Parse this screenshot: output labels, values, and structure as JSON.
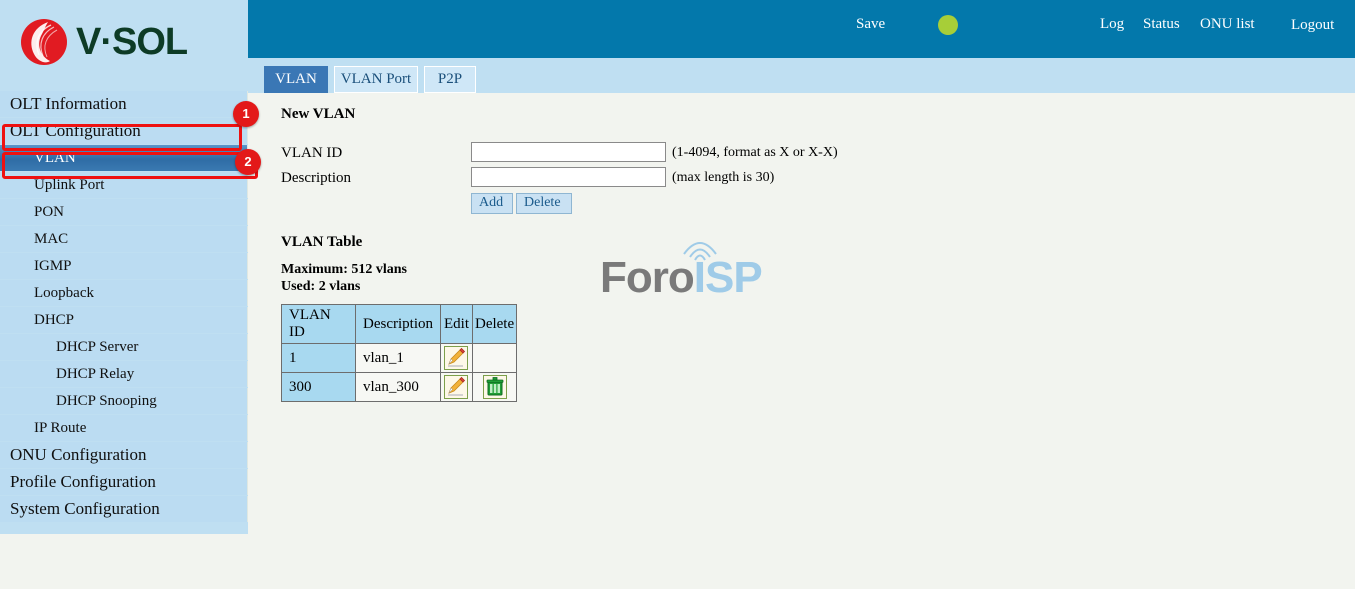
{
  "brand": {
    "name": "V·SOL",
    "logo_icon": "vsol-circle-logo"
  },
  "topbar": {
    "save_label": "Save",
    "status_indicator": "green-status-dot",
    "links": [
      {
        "label": "Log"
      },
      {
        "label": "Status"
      },
      {
        "label": "ONU list"
      },
      {
        "label": "Logout"
      }
    ]
  },
  "tabs": [
    {
      "label": "VLAN",
      "active": true
    },
    {
      "label": "VLAN Port",
      "active": false
    },
    {
      "label": "P2P",
      "active": false
    }
  ],
  "sidebar": {
    "items": [
      {
        "label": "OLT Information",
        "level": 0,
        "active": false
      },
      {
        "label": "OLT Configuration",
        "level": 0,
        "active": false
      },
      {
        "label": "VLAN",
        "level": 1,
        "active": true
      },
      {
        "label": "Uplink Port",
        "level": 1,
        "active": false
      },
      {
        "label": "PON",
        "level": 1,
        "active": false
      },
      {
        "label": "MAC",
        "level": 1,
        "active": false
      },
      {
        "label": "IGMP",
        "level": 1,
        "active": false
      },
      {
        "label": "Loopback",
        "level": 1,
        "active": false
      },
      {
        "label": "DHCP",
        "level": 1,
        "active": false
      },
      {
        "label": "DHCP Server",
        "level": 2,
        "active": false
      },
      {
        "label": "DHCP Relay",
        "level": 2,
        "active": false
      },
      {
        "label": "DHCP Snooping",
        "level": 2,
        "active": false
      },
      {
        "label": "IP Route",
        "level": 1,
        "active": false
      },
      {
        "label": "ONU Configuration",
        "level": 0,
        "active": false
      },
      {
        "label": "Profile Configuration",
        "level": 0,
        "active": false
      },
      {
        "label": "System Configuration",
        "level": 0,
        "active": false
      }
    ]
  },
  "annotations": [
    {
      "number": "1",
      "target": "OLT Configuration"
    },
    {
      "number": "2",
      "target": "VLAN"
    }
  ],
  "new_vlan": {
    "heading": "New VLAN",
    "vlan_id_label": "VLAN ID",
    "vlan_id_value": "",
    "vlan_id_hint": "(1-4094, format as X or X-X)",
    "description_label": "Description",
    "description_value": "",
    "description_hint": "(max length is 30)",
    "add_label": "Add",
    "delete_label": "Delete"
  },
  "vlan_table": {
    "heading": "VLAN Table",
    "maximum_line": "Maximum: 512 vlans",
    "used_line": "Used: 2 vlans",
    "columns": [
      "VLAN ID",
      "Description",
      "Edit",
      "Delete"
    ],
    "rows": [
      {
        "vlan_id": "1",
        "description": "vlan_1",
        "edit_icon": "pencil-edit-icon",
        "delete_icon": ""
      },
      {
        "vlan_id": "300",
        "description": "vlan_300",
        "edit_icon": "pencil-edit-icon",
        "delete_icon": "trash-delete-icon"
      }
    ]
  },
  "watermark": {
    "text_primary": "Foro",
    "text_secondary": "ISP"
  },
  "colors": {
    "header_blue": "#0378ab",
    "sidebar_blue": "#bbdcf2",
    "active_nav": "#2f6ca5",
    "status_green": "#a7ce38",
    "annotation_red": "#e31919",
    "content_bg": "#f2f4ef",
    "table_header": "#a8d9f0"
  }
}
